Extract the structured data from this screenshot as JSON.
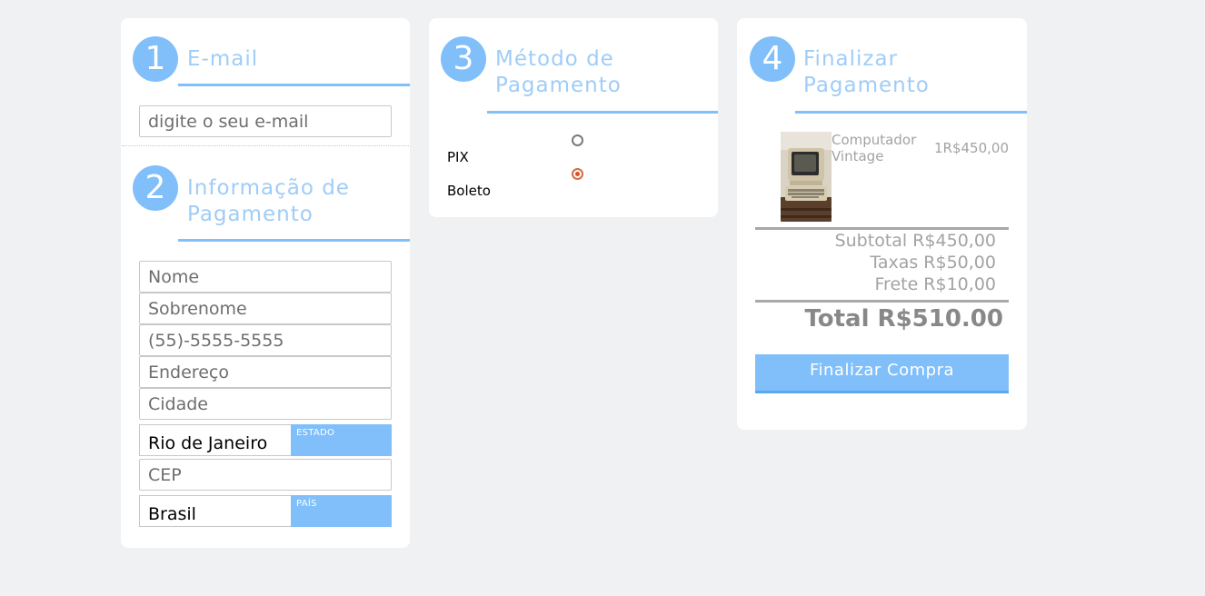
{
  "sections": {
    "email": {
      "number": "1",
      "title": "E-mail",
      "input_placeholder": "digite o seu e-mail"
    },
    "info": {
      "number": "2",
      "title_line1": "Informação de",
      "title_line2": "Pagamento",
      "fields": {
        "nome_placeholder": "Nome",
        "sobrenome_placeholder": "Sobrenome",
        "telefone_placeholder": "(55)-5555-5555",
        "endereco_placeholder": "Endereço",
        "cidade_placeholder": "Cidade",
        "cep_placeholder": "CEP"
      },
      "estado": {
        "value": "Rio de Janeiro",
        "tag": "ESTADO"
      },
      "pais": {
        "value": "Brasil",
        "tag": "PAÍS"
      }
    },
    "payment_method": {
      "number": "3",
      "title_line1": "Método de",
      "title_line2": "Pagamento",
      "options": [
        {
          "label": "PIX",
          "selected": false
        },
        {
          "label": "Boleto",
          "selected": true
        }
      ]
    },
    "finalize": {
      "number": "4",
      "title_line1": "Finalizar",
      "title_line2": "Pagamento",
      "product": {
        "name": "Computador Vintage",
        "price": "1R$450,00",
        "image": "vintage-computer-photo"
      },
      "subtotal": "Subtotal R$450,00",
      "taxes": "Taxas R$50,00",
      "shipping": "Frete R$10,00",
      "total": "Total R$510.00",
      "button_label": "Finalizar Compra"
    }
  },
  "colors": {
    "accent": "#80bff9",
    "title": "#9fcdf7",
    "background": "#f0f1f3",
    "radio_selected": "#d9502a",
    "muted_text": "#a3a3a3"
  }
}
